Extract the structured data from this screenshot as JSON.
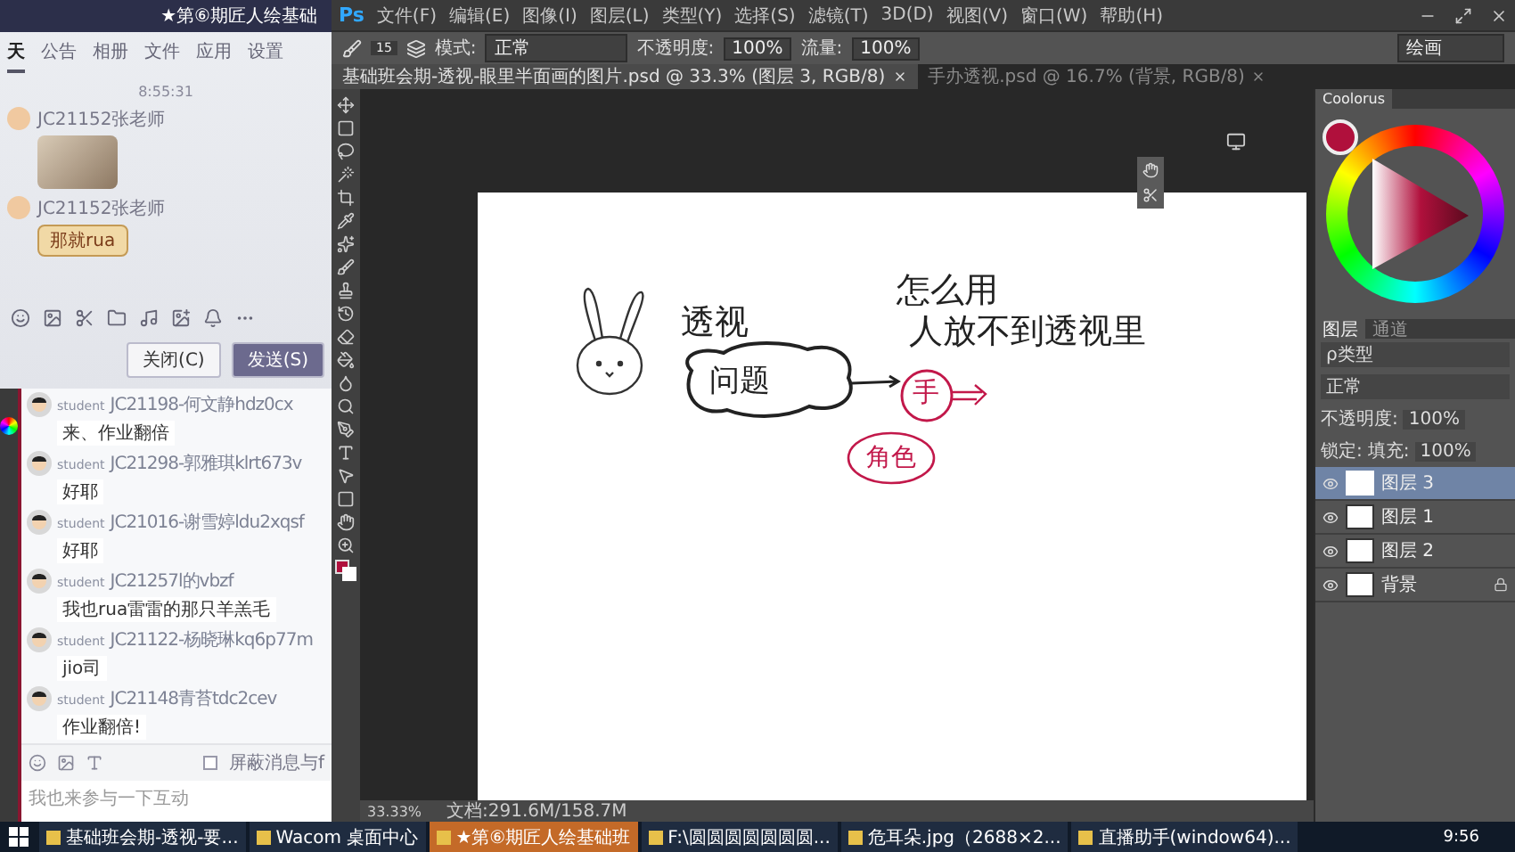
{
  "chat_window": {
    "title": "★第⑥期匠人绘基础",
    "tabs": [
      {
        "label": "天",
        "selected": true
      },
      {
        "label": "公告",
        "selected": false
      },
      {
        "label": "相册",
        "selected": false
      },
      {
        "label": "文件",
        "selected": false
      },
      {
        "label": "应用",
        "selected": false
      },
      {
        "label": "设置",
        "selected": false
      }
    ],
    "timestamp": "8:55:31",
    "messages": [
      {
        "kind": "image",
        "sender": "JC21152张老师"
      },
      {
        "kind": "sticker",
        "sender": "JC21152张老师",
        "text": "那就rua"
      }
    ],
    "buttons": [
      {
        "label": "关闭(C)",
        "primary": false
      },
      {
        "label": "发送(S)",
        "primary": true
      }
    ]
  },
  "live_chat": {
    "messages": [
      {
        "role": "student",
        "sender": "JC21198-何文静hdz0cx",
        "text": "来、作业翻倍"
      },
      {
        "role": "student",
        "sender": "JC21298-郭雅琪klrt673v",
        "text": "好耶"
      },
      {
        "role": "student",
        "sender": "JC21016-谢雪婷ldu2xqsf",
        "text": "好耶"
      },
      {
        "role": "student",
        "sender": "JC21257l的vbzf",
        "text": "我也rua雷雷的那只羊羔毛"
      },
      {
        "role": "student",
        "sender": "JC21122-杨晓琳kq6p77m",
        "text": "jio司"
      },
      {
        "role": "student",
        "sender": "JC21148青苔tdc2cev",
        "text": "作业翻倍!"
      }
    ],
    "block_option": {
      "label": "屏蔽消息与f",
      "checked": false
    },
    "input": {
      "placeholder": "我也来参与一下互动"
    }
  },
  "photoshop": {
    "logo": "Ps",
    "menu": [
      "文件(F)",
      "编辑(E)",
      "图像(I)",
      "图层(L)",
      "类型(Y)",
      "选择(S)",
      "滤镜(T)",
      "3D(D)",
      "视图(V)",
      "窗口(W)",
      "帮助(H)"
    ],
    "options": {
      "brush_size": "15",
      "mode_label": "模式:",
      "mode": "正常",
      "opacity_label": "不透明度:",
      "opacity": "100%",
      "flow_label": "流量:",
      "flow": "100%",
      "workspace": "绘画"
    },
    "doc_tabs": [
      {
        "label": "基础班会期-透视-眼里半面画的图片.psd @ 33.3% (图层 3, RGB/8)",
        "selected": true
      },
      {
        "label": "手办透视.psd @ 16.7% (背景, RGB/8)",
        "selected": false
      }
    ],
    "canvas_notes": [
      {
        "text": "透视",
        "color": "#222222"
      },
      {
        "text": "问题",
        "color": "#222222"
      },
      {
        "text": "怎么用",
        "color": "#222222"
      },
      {
        "text": "人放不到透视里",
        "color": "#222222"
      },
      {
        "text": "手",
        "color": "#c2184a"
      },
      {
        "text": "角色",
        "color": "#c2184a"
      }
    ],
    "status": {
      "zoom": "33.33%",
      "doc": "文档:291.6M/158.7M"
    },
    "color_panel": {
      "title": "Coolorus"
    },
    "layers_panel": {
      "tabs": [
        {
          "label": "图层",
          "selected": true
        },
        {
          "label": "通道",
          "selected": false
        }
      ],
      "filter": "ρ类型",
      "blend": "正常",
      "opacity_label": "不透明度:",
      "opacity": "100%",
      "lock_label": "锁定:",
      "fill_label": "填充:",
      "fill": "100%",
      "layers": [
        {
          "name": "图层 3",
          "selected": true,
          "locked": false
        },
        {
          "name": "图层 1",
          "selected": false,
          "locked": false
        },
        {
          "name": "图层 2",
          "selected": false,
          "locked": false
        },
        {
          "name": "背景",
          "selected": false,
          "locked": true
        }
      ]
    }
  },
  "taskbar": {
    "items": [
      {
        "label": "基础班会期-透视-要...",
        "selected": false
      },
      {
        "label": "Wacom 桌面中心",
        "selected": false
      },
      {
        "label": "★第⑥期匠人绘基础班",
        "selected": true
      },
      {
        "label": "F:\\圆圆圆圆圆圆圆...",
        "selected": false
      },
      {
        "label": "危耳朵.jpg（2688×2...",
        "selected": false
      },
      {
        "label": "直播助手(window64)...",
        "selected": false
      }
    ],
    "clock": "9:56"
  }
}
